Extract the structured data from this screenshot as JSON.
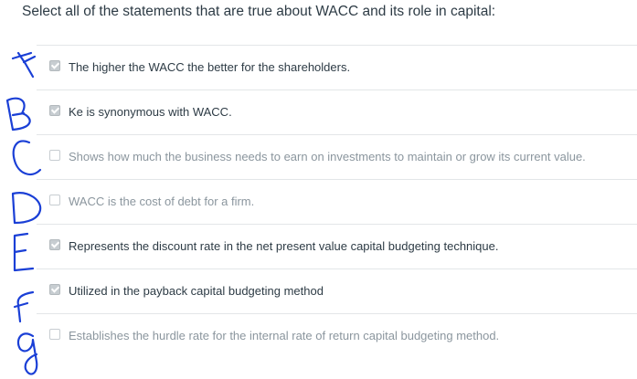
{
  "question": "Select all of the statements that are true about WACC and its role in capital:",
  "options": [
    {
      "text": "The higher the WACC the better for the shareholders.",
      "checked": true
    },
    {
      "text": "Ke is synonymous with WACC.",
      "checked": true
    },
    {
      "text": "Shows how much the business needs to earn on investments to maintain or grow its current value.",
      "checked": false
    },
    {
      "text": "WACC is the cost of debt for a firm.",
      "checked": false
    },
    {
      "text": "Represents the discount rate in the net present value capital budgeting technique.",
      "checked": true
    },
    {
      "text": "Utilized in the payback capital budgeting method",
      "checked": true
    },
    {
      "text": "Establishes the hurdle rate for the internal rate of return capital budgeting method.",
      "checked": false
    }
  ],
  "annotations": [
    "A",
    "B",
    "C",
    "D",
    "E",
    "F",
    "G"
  ],
  "colors": {
    "handwriting": "#1a3fd6",
    "text": "#2d3b45",
    "muted": "#8b969e"
  }
}
